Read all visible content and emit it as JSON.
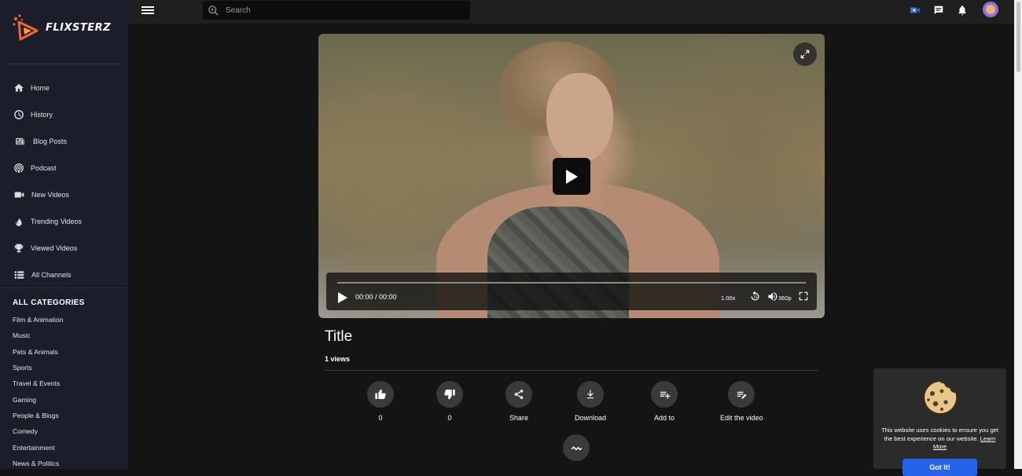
{
  "app": {
    "name": "FLIXSTERZ"
  },
  "header": {
    "search_placeholder": "Search"
  },
  "sidebar": {
    "items": [
      {
        "label": "Home",
        "icon": "home-icon"
      },
      {
        "label": "History",
        "icon": "history-icon"
      },
      {
        "label": "Blog Posts",
        "icon": "newspaper-icon"
      },
      {
        "label": "Podcast",
        "icon": "podcast-icon"
      },
      {
        "label": "New Videos",
        "icon": "video-camera-icon"
      },
      {
        "label": "Trending Videos",
        "icon": "flame-icon"
      },
      {
        "label": "Viewed Videos",
        "icon": "trophy-icon"
      },
      {
        "label": "All Channels",
        "icon": "list-icon"
      }
    ],
    "categories_heading": "ALL CATEGORIES",
    "categories": [
      "Film & Animation",
      "Music",
      "Pets & Animals",
      "Sports",
      "Travel & Events",
      "Gaming",
      "People & Blogs",
      "Comedy",
      "Entertainment",
      "News & Politics"
    ]
  },
  "player": {
    "time": "00:00 / 00:00",
    "speed": "1.00x",
    "quality": "360p",
    "progress": 0
  },
  "video": {
    "title": "Title",
    "views": "1 views"
  },
  "actions": [
    {
      "label": "0",
      "icon": "thumbs-up-icon"
    },
    {
      "label": "0",
      "icon": "thumbs-down-icon"
    },
    {
      "label": "Share",
      "icon": "share-icon"
    },
    {
      "label": "Download",
      "icon": "download-icon"
    },
    {
      "label": "Add to",
      "icon": "playlist-add-icon"
    },
    {
      "label": "Edit the video",
      "icon": "edit-list-icon"
    }
  ],
  "cookie": {
    "message": "This website uses cookies to ensure you get the best experience on our website.",
    "link": "Learn More",
    "button": "Got It!"
  },
  "colors": {
    "accent": "#2563eb",
    "sidebar_bg": "#1b1d2a",
    "page_bg": "#141414"
  }
}
